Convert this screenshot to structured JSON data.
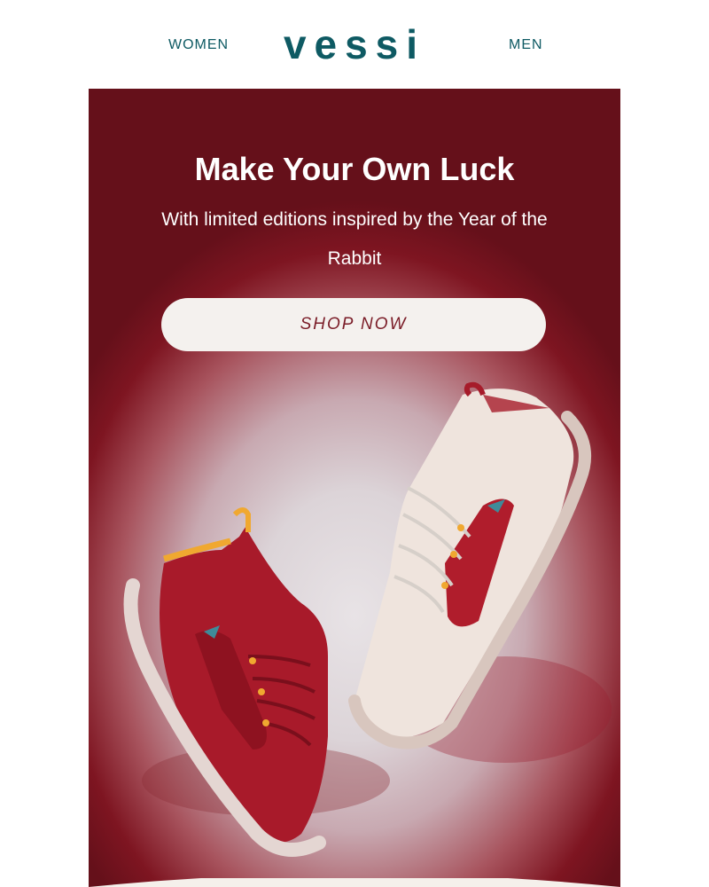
{
  "nav": {
    "women": "WOMEN",
    "brand": "vessi",
    "men": "MEN"
  },
  "hero": {
    "title": "Make Your Own Luck",
    "subtitle": "With limited editions inspired by the Year of the Rabbit",
    "cta": "SHOP NOW"
  },
  "colors": {
    "brand_teal": "#0e5a63",
    "hero_red": "#7e1521",
    "button_bg": "#f4f1ee",
    "button_text": "#7a1c27"
  },
  "images": {
    "shoe_left": "red-knit-sneaker",
    "shoe_right": "cream-knit-sneaker"
  }
}
